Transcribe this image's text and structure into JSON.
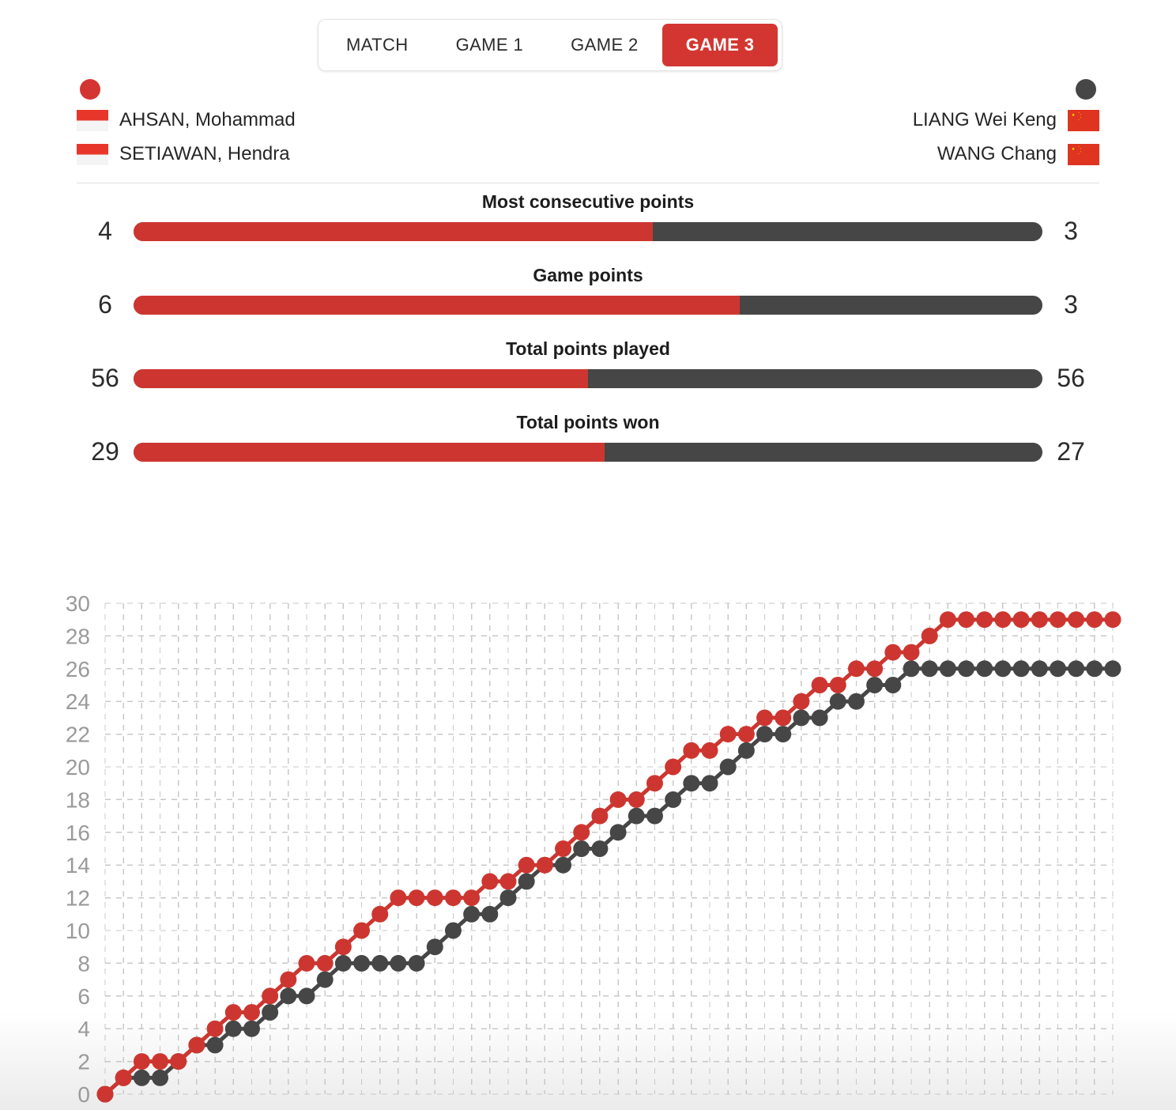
{
  "tabs": [
    {
      "label": "MATCH",
      "active": false
    },
    {
      "label": "GAME 1",
      "active": false
    },
    {
      "label": "GAME 2",
      "active": false
    },
    {
      "label": "GAME 3",
      "active": true
    }
  ],
  "colors": {
    "team_a": "#cd3630",
    "team_b": "#464646",
    "tab_active_bg": "#d33630",
    "grid": "#c8c8c8",
    "axis_label": "#9a9a9a"
  },
  "legend": {
    "left": {
      "marker": "red-dot-marker",
      "country": "Indonesia",
      "players": [
        "AHSAN, Mohammad",
        "SETIAWAN, Hendra"
      ]
    },
    "right": {
      "marker": "dark-dot-marker",
      "country": "China",
      "players": [
        "LIANG Wei Keng",
        "WANG Chang"
      ]
    }
  },
  "stats": [
    {
      "title": "Most consecutive points",
      "left": "4",
      "right": "3",
      "left_pct": 57.1
    },
    {
      "title": "Game points",
      "left": "6",
      "right": "3",
      "left_pct": 66.7
    },
    {
      "title": "Total points played",
      "left": "56",
      "right": "56",
      "left_pct": 50.0
    },
    {
      "title": "Total points won",
      "left": "29",
      "right": "27",
      "left_pct": 51.8
    }
  ],
  "chart_data": {
    "type": "line",
    "title": "",
    "xlabel": "",
    "ylabel": "",
    "ylim": [
      0,
      30
    ],
    "yticks": [
      0,
      2,
      4,
      6,
      8,
      10,
      12,
      14,
      16,
      18,
      20,
      22,
      24,
      26,
      28,
      30
    ],
    "grid": true,
    "legend_position": "top",
    "x": [
      0,
      1,
      2,
      3,
      4,
      5,
      6,
      7,
      8,
      9,
      10,
      11,
      12,
      13,
      14,
      15,
      16,
      17,
      18,
      19,
      20,
      21,
      22,
      23,
      24,
      25,
      26,
      27,
      28,
      29,
      30,
      31,
      32,
      33,
      34,
      35,
      36,
      37,
      38,
      39,
      40,
      41,
      42,
      43,
      44,
      45,
      46,
      47,
      48,
      49,
      50,
      51,
      52,
      53,
      54,
      55
    ],
    "series": [
      {
        "name": "AHSAN, Mohammad / SETIAWAN, Hendra",
        "color": "#cd3630",
        "values": [
          0,
          1,
          2,
          2,
          2,
          3,
          4,
          5,
          5,
          6,
          7,
          8,
          8,
          9,
          10,
          11,
          12,
          12,
          12,
          12,
          12,
          13,
          13,
          14,
          14,
          15,
          16,
          17,
          18,
          18,
          19,
          20,
          21,
          21,
          22,
          22,
          23,
          23,
          24,
          25,
          25,
          26,
          26,
          27,
          27,
          28,
          29,
          29,
          29,
          29,
          29,
          29,
          29,
          29,
          29,
          29
        ]
      },
      {
        "name": "LIANG Wei Keng / WANG Chang",
        "color": "#464646",
        "values": [
          0,
          1,
          1,
          1,
          2,
          3,
          3,
          4,
          4,
          5,
          6,
          6,
          7,
          8,
          8,
          8,
          8,
          8,
          9,
          10,
          11,
          11,
          12,
          13,
          14,
          14,
          15,
          15,
          16,
          17,
          17,
          18,
          19,
          19,
          20,
          21,
          22,
          22,
          23,
          23,
          24,
          24,
          25,
          25,
          26,
          26,
          26,
          26,
          26,
          26,
          26,
          26,
          26,
          26,
          26,
          26
        ]
      }
    ]
  }
}
